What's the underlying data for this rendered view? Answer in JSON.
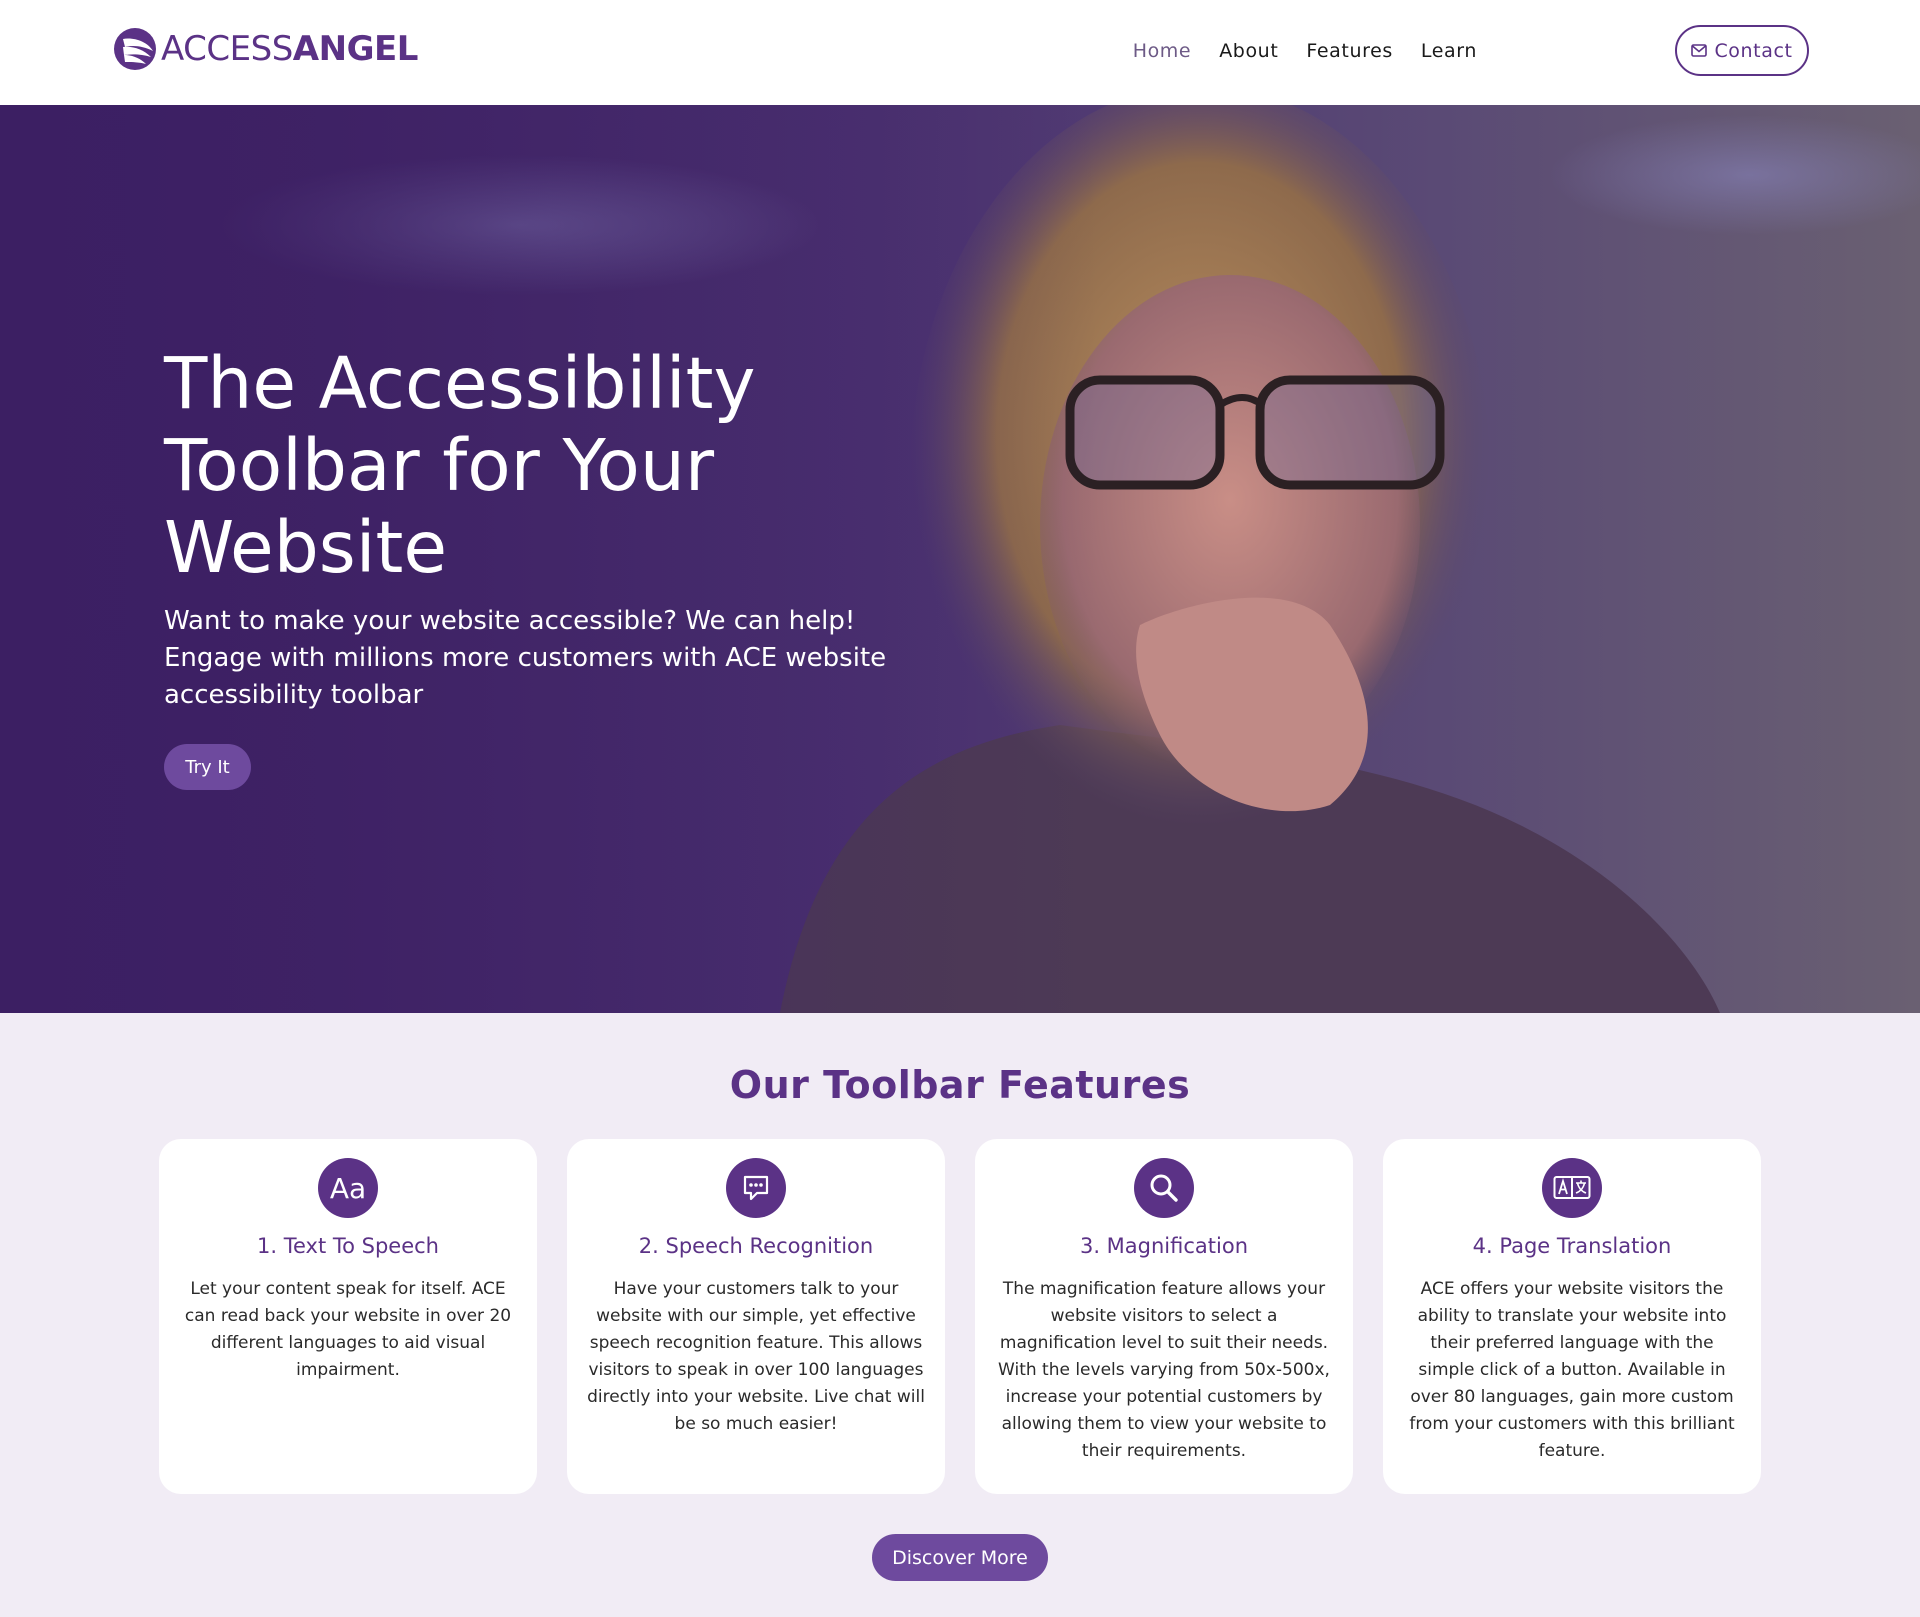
{
  "header": {
    "logo": {
      "part1": "ACCESS",
      "part2": "ANGEL"
    },
    "nav": [
      {
        "label": "Home",
        "active": true
      },
      {
        "label": "About",
        "active": false
      },
      {
        "label": "Features",
        "active": false
      },
      {
        "label": "Learn",
        "active": false
      }
    ],
    "contact_label": "Contact",
    "icons": {
      "contact": "envelope-icon",
      "logo": "angel-wing-icon"
    }
  },
  "hero": {
    "title": "The Accessibility Toolbar for Your Website",
    "subtitle": "Want to make your website accessible? We can help! Engage with millions more customers with ACE website accessibility toolbar",
    "cta_label": "Try It"
  },
  "features": {
    "title": "Our Toolbar Features",
    "cards": [
      {
        "icon": "text-aa-icon",
        "icon_text": "Aa",
        "title": "1. Text To Speech",
        "text": "Let your content speak for itself. ACE can read back your website in over 20 different languages to aid visual impairment."
      },
      {
        "icon": "chat-bubble-icon",
        "title": "2. Speech Recognition",
        "text": "Have your customers talk to your website with our simple, yet effective speech recognition feature. This allows visitors to speak in over 100 languages directly into your website. Live chat will be so much easier!"
      },
      {
        "icon": "magnifier-icon",
        "title": "3. Magnification",
        "text": "The magnification feature allows your website visitors to select a magnification level to suit their needs. With the levels varying from 50x-500x, increase your potential customers by allowing them to view your website to their requirements."
      },
      {
        "icon": "translate-icon",
        "title": "4. Page Translation",
        "text": "ACE offers your website visitors the ability to translate your website into their preferred language with the simple click of a button. Available in over 80 languages, gain more custom from your customers with this brilliant feature."
      }
    ],
    "discover_label": "Discover More"
  },
  "colors": {
    "brand_purple": "#5b3286",
    "button_purple": "#6e4a9e",
    "section_bg": "#f1ecf5"
  }
}
